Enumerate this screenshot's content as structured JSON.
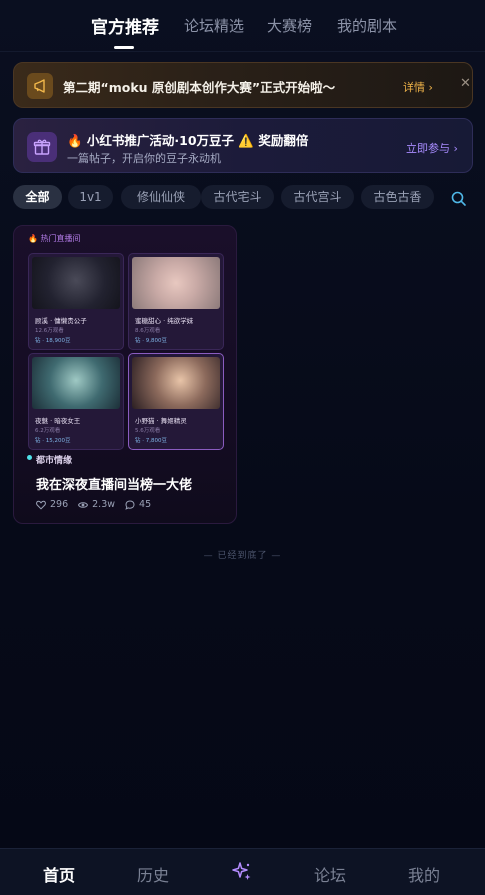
{
  "top_tabs": [
    {
      "label": "官方推荐",
      "active": true
    },
    {
      "label": "论坛精选",
      "active": false
    },
    {
      "label": "大赛榜",
      "active": false
    },
    {
      "label": "我的剧本",
      "active": false
    }
  ],
  "banner_contest": {
    "icon": "megaphone-icon",
    "text": "第二期“moku 原创剧本创作大赛”正式开始啦～",
    "detail_label": "详情 ›",
    "close_label": "✕"
  },
  "banner_promo": {
    "icon": "gift-icon",
    "title": "🔥 小红书推广活动·10万豆子 ⚠️ 奖励翻倍",
    "subtitle": "一篇帖子，开启你的豆子永动机",
    "join_label": "立即参与 ›"
  },
  "filters": [
    "全部",
    "1v1",
    "修仙仙侠",
    "古代宅斗",
    "古代宫斗",
    "古色古香"
  ],
  "active_filter": "全部",
  "card": {
    "hot_label": "🔥 热门直播间",
    "streams": [
      {
        "name": "顾溪 · 慵懒贵公子",
        "views": "12.6万观看",
        "gifts": "钻 · 18,900豆"
      },
      {
        "name": "蜜糖甜心 · 纯欲学妹",
        "views": "8.6万观看",
        "gifts": "钻 · 9,800豆"
      },
      {
        "name": "夜魅 · 暗夜女王",
        "views": "6.2万观看",
        "gifts": "钻 · 15,200豆"
      },
      {
        "name": "小野猫 · 舞姬精灵",
        "views": "5.6万观看",
        "gifts": "钻 · 7,800豆"
      }
    ],
    "genre": "都市情缘",
    "title": "我在深夜直播间当榜一大佬",
    "likes": "296",
    "views": "2.3w",
    "comments": "45"
  },
  "end_text": "— 已经到底了 —",
  "bottom_nav": [
    {
      "label": "首页",
      "active": true
    },
    {
      "label": "历史",
      "active": false
    },
    {
      "label": "",
      "icon": "sparkle-icon"
    },
    {
      "label": "论坛",
      "active": false
    },
    {
      "label": "我的",
      "active": false
    }
  ],
  "colors": {
    "accent_purple": "#a98cff",
    "accent_gold": "#f0b44a",
    "background": "#070b1a"
  }
}
